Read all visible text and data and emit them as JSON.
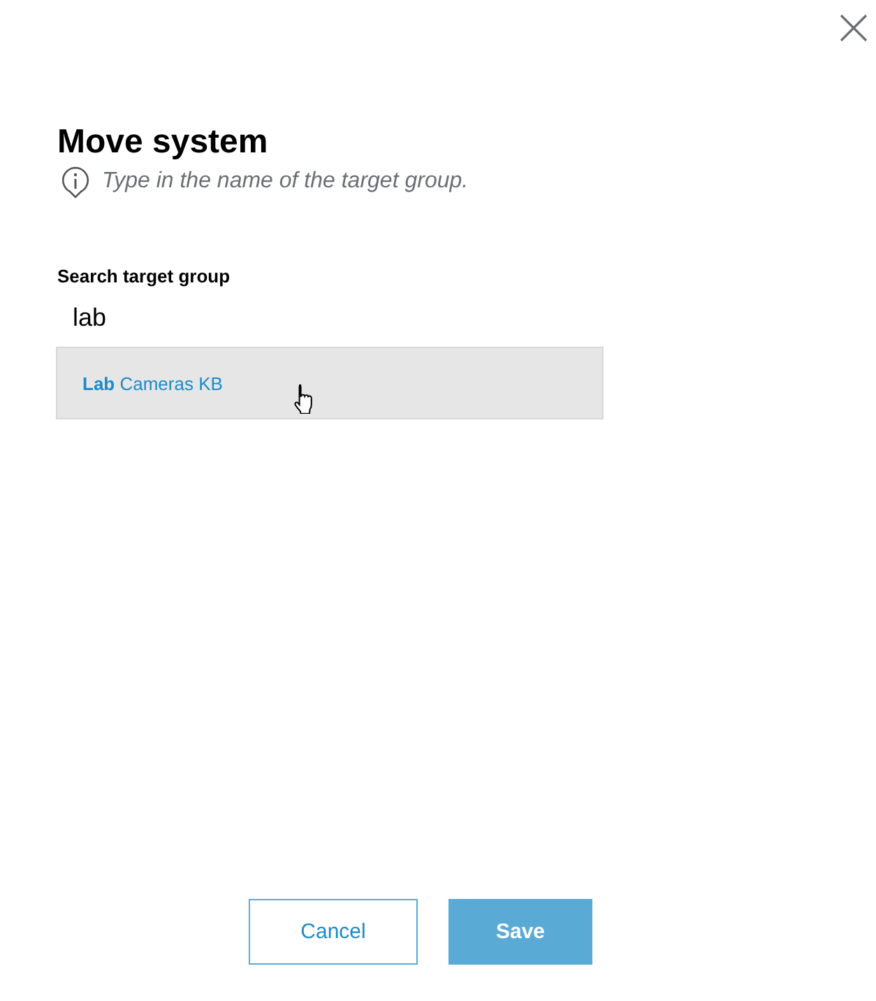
{
  "dialog": {
    "title": "Move system",
    "hint": "Type in the name of the target group."
  },
  "search": {
    "label": "Search target group",
    "value": "lab"
  },
  "suggestions": [
    {
      "text": "**Lab** Cameras KB",
      "selected": true
    }
  ],
  "buttons": [
    {
      "label": "Cancel",
      "kind": "secondary"
    },
    {
      "label": "Save",
      "kind": "primary"
    }
  ]
}
